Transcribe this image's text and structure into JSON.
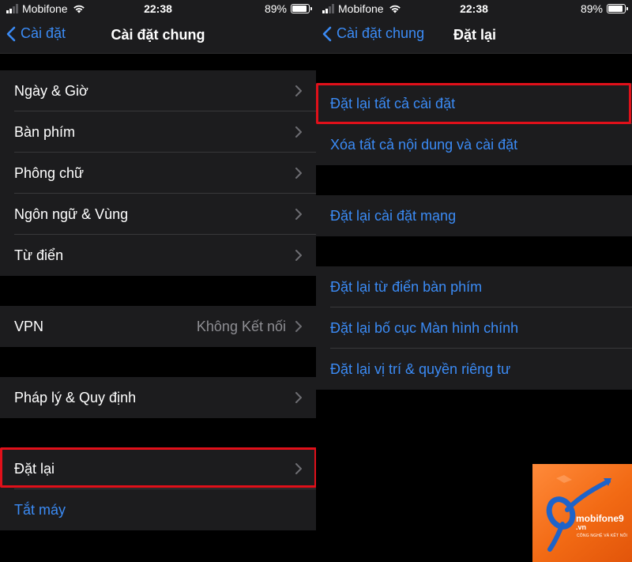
{
  "status_bar": {
    "carrier": "Mobifone",
    "time": "22:38",
    "battery_percent": "89%",
    "battery_level": 0.89
  },
  "left_screen": {
    "back_label": "Cài đặt",
    "title": "Cài đặt chung",
    "group1": [
      {
        "label": "Ngày & Giờ"
      },
      {
        "label": "Bàn phím"
      },
      {
        "label": "Phông chữ"
      },
      {
        "label": "Ngôn ngữ & Vùng"
      },
      {
        "label": "Từ điển"
      }
    ],
    "vpn": {
      "label": "VPN",
      "value": "Không Kết nối"
    },
    "legal": {
      "label": "Pháp lý & Quy định"
    },
    "reset": {
      "label": "Đặt lại"
    },
    "shutdown": {
      "label": "Tắt máy"
    }
  },
  "right_screen": {
    "back_label": "Cài đặt chung",
    "title": "Đặt lại",
    "group1": [
      {
        "label": "Đặt lại tất cả cài đặt"
      },
      {
        "label": "Xóa tất cả nội dung và cài đặt"
      }
    ],
    "group2": [
      {
        "label": "Đặt lại cài đặt mạng"
      }
    ],
    "group3": [
      {
        "label": "Đặt lại từ điển bàn phím"
      },
      {
        "label": "Đặt lại bố cục Màn hình chính"
      },
      {
        "label": "Đặt lại vị trí & quyền riêng tư"
      }
    ]
  },
  "watermark": {
    "brand": "mobifone9",
    "domain": ".vn",
    "tagline": "CÔNG NGHỆ VÀ KẾT NỐI"
  },
  "colors": {
    "accent": "#3b8bf5",
    "highlight": "#e0101a",
    "cell_bg": "#1c1c1e",
    "page_bg": "#000000"
  }
}
